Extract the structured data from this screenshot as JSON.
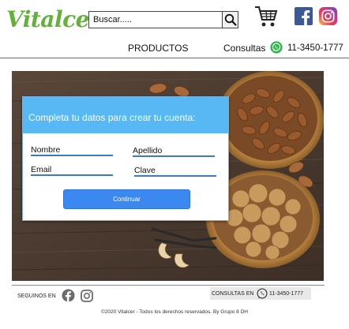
{
  "brand": {
    "name": "Vitalcer",
    "color": "#62b23a"
  },
  "search": {
    "placeholder": "Buscar....."
  },
  "nav": {
    "products": "PRODUCTOS",
    "consultas": "Consultas",
    "phone": "11-3450-1777"
  },
  "icons": {
    "search": "magnifier-icon",
    "cart": "shopping-cart-icon",
    "facebook": "facebook-icon",
    "instagram": "instagram-icon",
    "whatsapp": "whatsapp-icon"
  },
  "form": {
    "title": "Completa tu datos para crear tu cuenta:",
    "fields": {
      "nombre": "Nombre",
      "apellido": "Apellido",
      "email": "Email",
      "clave": "Clave"
    },
    "submit": "Continuar"
  },
  "footer": {
    "follow": "SEGUINOS EN",
    "consultas": "CONSULTAS EN",
    "phone": "11-3450-1777",
    "copyright": "©2020 Vitalcer - Todos los derechos reservados. By Grupo 8 DH"
  },
  "colors": {
    "form_header": "#58b8f4",
    "button": "#3b88f1",
    "field_underline": "#3a7cbc",
    "facebook": "#3b5998",
    "whatsapp": "#2fb54a",
    "wood": "#4a3a30"
  }
}
